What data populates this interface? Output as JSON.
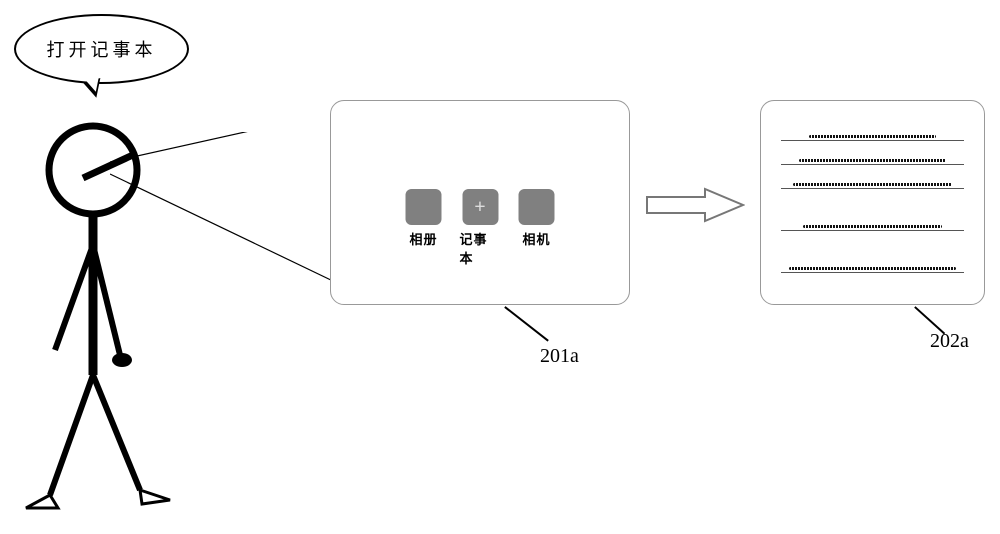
{
  "speech": {
    "text": "打开记事本"
  },
  "screen_left": {
    "apps": [
      {
        "label": "相册",
        "icon_glyph": ""
      },
      {
        "label": "记事本",
        "icon_glyph": "+"
      },
      {
        "label": "相机",
        "icon_glyph": ""
      }
    ],
    "ref": "201a"
  },
  "screen_right": {
    "ref": "202a"
  }
}
